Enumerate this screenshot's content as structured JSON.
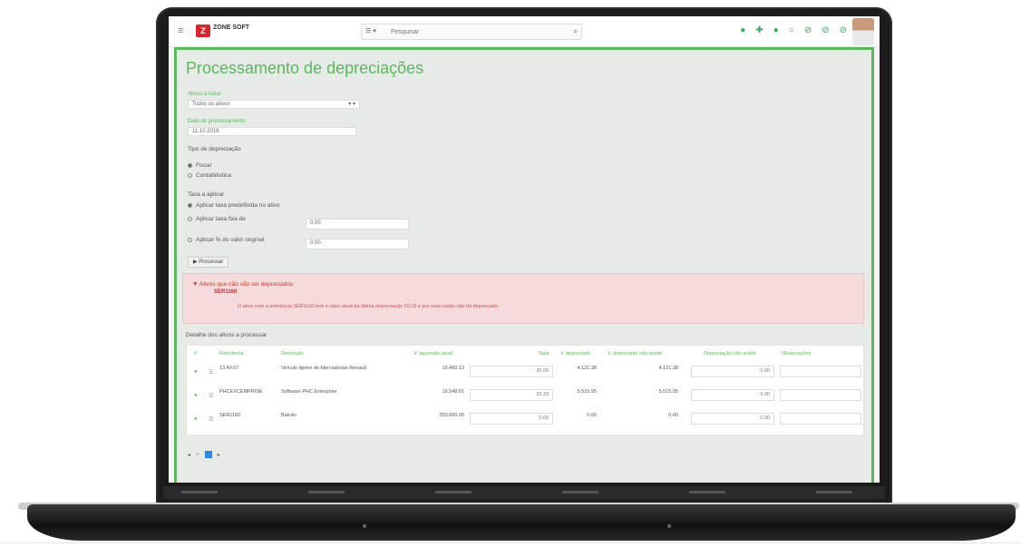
{
  "appbar": {
    "logo_text": "Z",
    "logo_caption": "ZONE\nSOFT",
    "search_scope": "☰ ▾",
    "search_placeholder": "Pesquisar",
    "icons": [
      "plus-icon",
      "plus-icon",
      "star-icon",
      "circle-icon",
      "tag-icon",
      "tag-icon",
      "tag-icon"
    ]
  },
  "page": {
    "title": "Processamento de depreciações"
  },
  "form": {
    "asset_label": "Ativos a tratar",
    "asset_value": "Todos os ativos",
    "date_label": "Data de processamento",
    "date_value": "11.10.2016",
    "type_label": "Tipo de depreciação",
    "type_options": [
      "Fiscal",
      "Contabilística"
    ],
    "rate_label": "Taxa a aplicar",
    "rate_options": [
      "Aplicar taxa predefinida no ativo",
      "Aplicar taxa fixa de",
      "Aplicar % do valor original"
    ],
    "rate_fixed_value": "0.00",
    "rate_percent_value": "0.00",
    "process_button": "▶ Processar"
  },
  "alert": {
    "title": "▼ Ativos que não vão ser depreciados",
    "code": "SER1160",
    "message": "O ativo com a referência SER1160 tem o valor atual da última depreciação 20.16 e por esse razão não foi depreciado."
  },
  "table": {
    "section_title": "Detalhe dos ativos a processar",
    "headers": [
      "#",
      "Referência",
      "Descrição",
      "V. aquisição atual",
      "Taxa",
      "V. depreciado",
      "V. depreciado não aceite",
      "Depreciação não aceite",
      "Observações"
    ],
    "rows": [
      {
        "ref": "13.40.07",
        "desc": "Veículo ligeiro de Mercadorias Renault",
        "acq": "16.460.13",
        "rate": "20.00",
        "dep": "4.121.38",
        "dep_na": "4.121.38",
        "na_input": "0.00",
        "obs": ""
      },
      {
        "ref": "PHCEXCEMPRISE",
        "desc": "Software PHC Enterprise",
        "acq": "16.548.01",
        "rate": "33.33",
        "dep": "5.515.95",
        "dep_na": "5.515.95",
        "na_input": "0.00",
        "obs": ""
      },
      {
        "ref": "SER1160",
        "desc": "Balcão",
        "acq": "250.000.00",
        "rate": "0.00",
        "dep": "0.00",
        "dep_na": "0.00",
        "na_input": "0.00",
        "obs": ""
      }
    ]
  },
  "pager": {
    "prev": "◂",
    "first": "○",
    "current": "",
    "next": "▸"
  },
  "colors": {
    "accent": "#5cb85c",
    "brand": "#d7262e",
    "alert_bg": "#f5dbdc",
    "content_bg": "#e6ebe7"
  }
}
